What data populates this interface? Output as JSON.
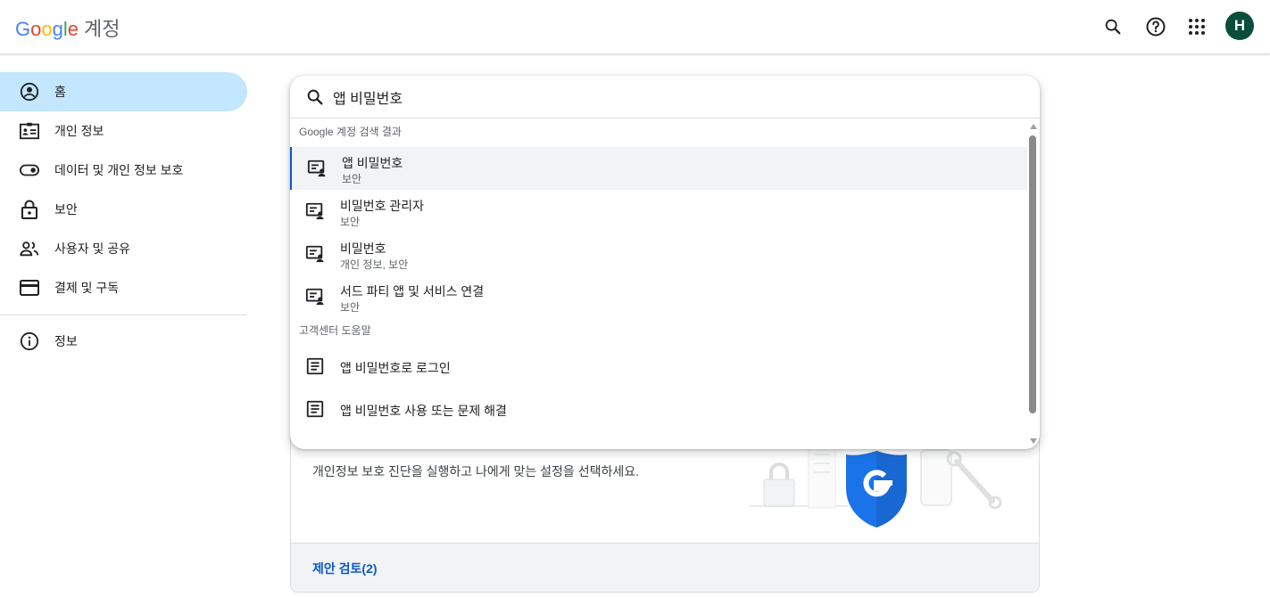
{
  "header": {
    "logo_letters": [
      "G",
      "o",
      "o",
      "g",
      "l",
      "e"
    ],
    "product": "계정",
    "icons": [
      "search-icon",
      "help-icon",
      "apps-icon"
    ],
    "avatar_initial": "H",
    "avatar_color": "#0b4d3a"
  },
  "sidebar": {
    "items": [
      {
        "label": "홈",
        "icon": "account-circle-icon",
        "active": true
      },
      {
        "label": "개인 정보",
        "icon": "id-card-icon"
      },
      {
        "label": "데이터 및 개인 정보 보호",
        "icon": "toggle-icon"
      },
      {
        "label": "보안",
        "icon": "lock-icon"
      },
      {
        "label": "사용자 및 공유",
        "icon": "people-icon"
      },
      {
        "label": "결제 및 구독",
        "icon": "credit-card-icon"
      }
    ],
    "info": {
      "label": "정보",
      "icon": "info-icon"
    }
  },
  "search": {
    "value": "앱 비밀번호",
    "section_account": "Google 계정 검색 결과",
    "account_results": [
      {
        "title": "앱 비밀번호",
        "sub": "보안"
      },
      {
        "title": "비밀번호 관리자",
        "sub": "보안"
      },
      {
        "title": "비밀번호",
        "sub": "개인 정보, 보안"
      },
      {
        "title": "서드 파티 앱 및 서비스 연결",
        "sub": "보안"
      }
    ],
    "section_help": "고객센터 도움말",
    "help_results": [
      {
        "title": "앱 비밀번호로 로그인"
      },
      {
        "title": "앱 비밀번호 사용 또는 문제 해결"
      }
    ]
  },
  "card": {
    "description": "개인정보 보호 진단을 실행하고 나에게 맞는 설정을 선택하세요.",
    "footer_link": "제안 검토(2)"
  },
  "colors": {
    "accent": "#0b57d0",
    "nav_active": "#c2e7ff",
    "shield": "#1a73e8"
  }
}
